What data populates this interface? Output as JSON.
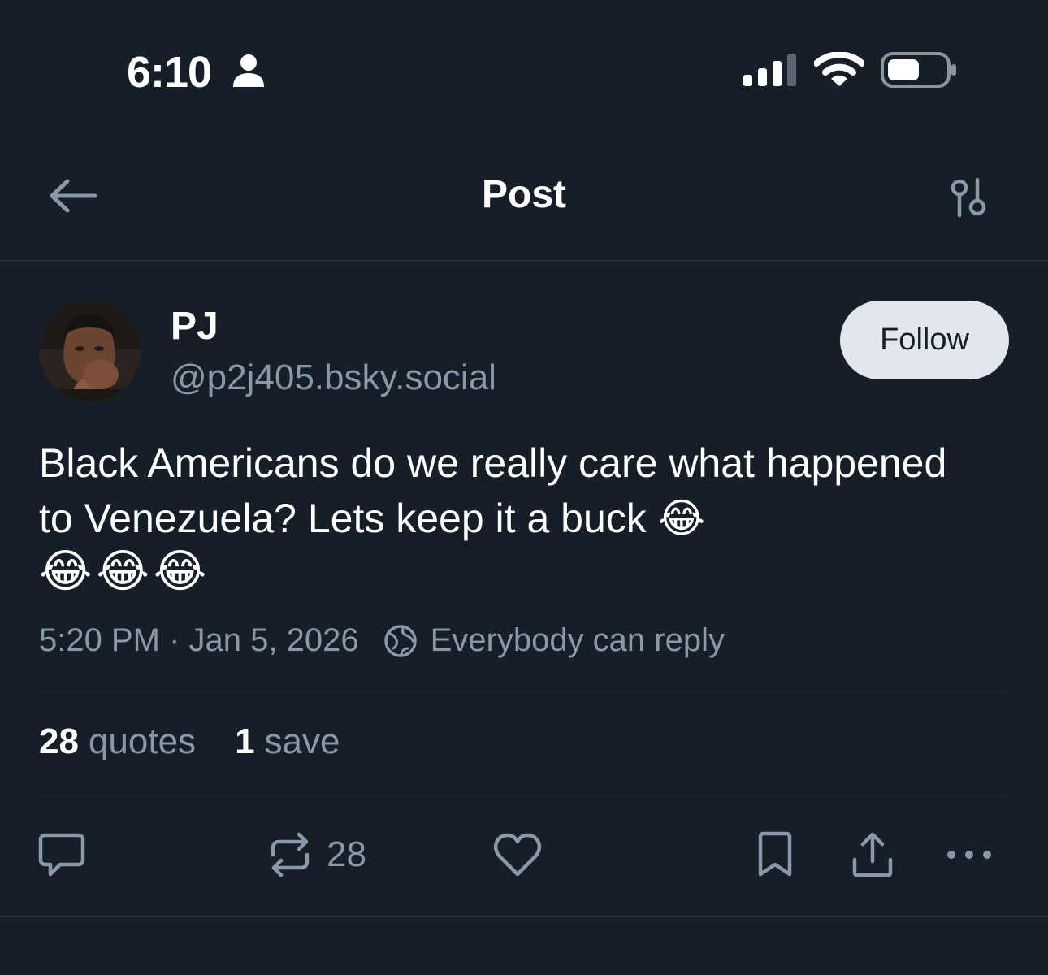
{
  "status_bar": {
    "time": "6:10",
    "icons": [
      "person-icon",
      "cellular-signal-icon",
      "wifi-icon",
      "battery-icon"
    ]
  },
  "header": {
    "title": "Post",
    "back_icon": "arrow-left-icon",
    "settings_icon": "sliders-icon"
  },
  "author": {
    "display_name": "PJ",
    "handle": "@p2j405.bsky.social",
    "follow_label": "Follow"
  },
  "post": {
    "text_line": "Black Americans do we really care what happened to Venezuela? Lets keep it a buck",
    "emojis": [
      "😂",
      "😂",
      "😂",
      "😂"
    ],
    "timestamp": "5:20 PM · Jan 5, 2026",
    "reply_setting": "Everybody can reply"
  },
  "stats": {
    "quotes_count": "28",
    "quotes_label": "quotes",
    "saves_count": "1",
    "saves_label": "save"
  },
  "actions": {
    "reply_icon": "chat-bubble-icon",
    "repost_icon": "repost-icon",
    "repost_count": "28",
    "like_icon": "heart-icon",
    "bookmark_icon": "bookmark-icon",
    "share_icon": "share-icon",
    "more_icon": "ellipsis-icon"
  },
  "colors": {
    "background": "#161e27",
    "muted_text": "#8b98a9",
    "divider": "#2a3441",
    "follow_button_bg": "#e2e7ee"
  }
}
